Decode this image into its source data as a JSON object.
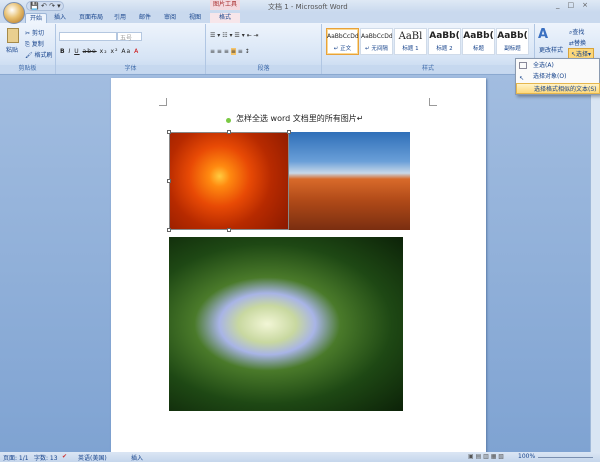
{
  "window": {
    "title": "文档 1 - Microsoft Word",
    "context_tab_title": "图片工具",
    "controls": [
      "_",
      "□",
      "×"
    ]
  },
  "quick_access": [
    "💾",
    "↶",
    "↷",
    "▾"
  ],
  "tabs": [
    "开始",
    "插入",
    "页面布局",
    "引用",
    "邮件",
    "审阅",
    "视图",
    "格式"
  ],
  "ribbon": {
    "clipboard": {
      "paste": "粘贴",
      "cut": "剪切",
      "copy": "复制",
      "format_painter": "格式刷",
      "label": "剪贴板"
    },
    "font": {
      "font_name": "",
      "font_size": "五号",
      "label": "字体",
      "buttons": [
        "B",
        "I",
        "U",
        "abe",
        "x₂",
        "x²",
        "Aa",
        "A"
      ]
    },
    "paragraph": {
      "label": "段落"
    },
    "styles": {
      "label": "样式",
      "items": [
        {
          "preview": "AaBbCcDd",
          "name": "↵ 正文"
        },
        {
          "preview": "AaBbCcDd",
          "name": "↵ 无间隔"
        },
        {
          "preview": "AaBl",
          "name": "标题 1"
        },
        {
          "preview": "AaBb(",
          "name": "标题 2"
        },
        {
          "preview": "AaBb(",
          "name": "标题"
        },
        {
          "preview": "AaBb(",
          "name": "副标题"
        }
      ],
      "change_styles": "更改样式"
    },
    "editing": {
      "find": "查找",
      "replace": "替换",
      "select": "选择"
    }
  },
  "select_menu": {
    "items": [
      "全选(A)",
      "选择对象(O)",
      "选择格式相似的文本(S)"
    ]
  },
  "document": {
    "heading": "怎样全选 word 文档里的所有图片↵"
  },
  "statusbar": {
    "page": "页面: 1/1",
    "words": "字数: 13",
    "language": "英语(美国)",
    "mode": "插入",
    "zoom": "100%"
  }
}
